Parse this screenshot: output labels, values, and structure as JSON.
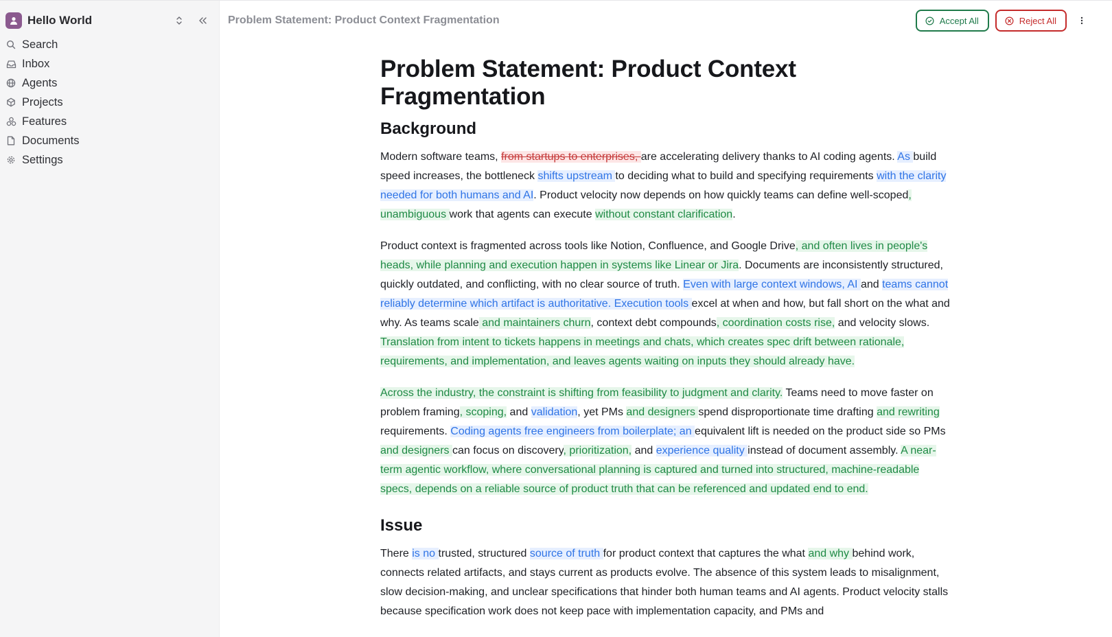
{
  "sidebar": {
    "workspace_name": "Hello World",
    "items": [
      {
        "label": "Search"
      },
      {
        "label": "Inbox"
      },
      {
        "label": "Agents"
      },
      {
        "label": "Projects"
      },
      {
        "label": "Features"
      },
      {
        "label": "Documents"
      },
      {
        "label": "Settings"
      }
    ]
  },
  "header": {
    "breadcrumb": "Problem Statement: Product Context Fragmentation",
    "accept_all": "Accept All",
    "reject_all": "Reject All"
  },
  "doc": {
    "title": "Problem Statement: Product Context Fragmentation",
    "background_heading": "Background",
    "issue_heading": "Issue",
    "p1": [
      {
        "t": "Modern software teams, ",
        "k": "n"
      },
      {
        "t": "from startups to enterprises, ",
        "k": "del"
      },
      {
        "t": "are accelerating delivery thanks to AI coding agents. ",
        "k": "n"
      },
      {
        "t": "As ",
        "k": "mod"
      },
      {
        "t": "build speed increases, the bottleneck ",
        "k": "n"
      },
      {
        "t": "shifts upstream ",
        "k": "mod"
      },
      {
        "t": "to deciding what to build and specifying requirements ",
        "k": "n"
      },
      {
        "t": "with the clarity needed for both humans and AI",
        "k": "mod"
      },
      {
        "t": ". Product velocity now depends on how quickly teams can define well-scoped",
        "k": "n"
      },
      {
        "t": ", unambiguous ",
        "k": "add"
      },
      {
        "t": "work that agents can execute ",
        "k": "n"
      },
      {
        "t": "without constant clarification",
        "k": "add"
      },
      {
        "t": ".",
        "k": "n"
      }
    ],
    "p2": [
      {
        "t": "Product context is fragmented across tools like Notion, Confluence, and Google Drive",
        "k": "n"
      },
      {
        "t": ", and often lives in people's heads, while planning and execution happen in systems like Linear or Jira",
        "k": "add"
      },
      {
        "t": ". Documents are inconsistently structured, quickly outdated, and conflicting, with no clear source of truth. ",
        "k": "n"
      },
      {
        "t": "Even with large context windows, AI ",
        "k": "mod"
      },
      {
        "t": "and ",
        "k": "n"
      },
      {
        "t": "teams cannot reliably determine which artifact is authoritative. Execution tools ",
        "k": "mod"
      },
      {
        "t": "excel at when and how, but fall short on the what and why. As teams scale",
        "k": "n"
      },
      {
        "t": " and maintainers churn",
        "k": "add"
      },
      {
        "t": ", context debt compounds",
        "k": "n"
      },
      {
        "t": ", coordination costs rise,",
        "k": "add"
      },
      {
        "t": " and velocity slows. ",
        "k": "n"
      },
      {
        "t": "Translation from intent to tickets happens in meetings and chats, which creates spec drift between rationale, requirements, and implementation, and leaves agents waiting on inputs they should already have.",
        "k": "add"
      }
    ],
    "p3": [
      {
        "t": "Across the industry, the constraint is shifting from feasibility to judgment and clarity.",
        "k": "add"
      },
      {
        "t": " Teams need to move faster on problem framing",
        "k": "n"
      },
      {
        "t": ", scoping,",
        "k": "add"
      },
      {
        "t": " and ",
        "k": "n"
      },
      {
        "t": "validation",
        "k": "mod"
      },
      {
        "t": ", yet PMs ",
        "k": "n"
      },
      {
        "t": "and designers ",
        "k": "add"
      },
      {
        "t": "spend disproportionate time drafting ",
        "k": "n"
      },
      {
        "t": "and rewriting ",
        "k": "add"
      },
      {
        "t": "requirements. ",
        "k": "n"
      },
      {
        "t": "Coding agents free engineers from boilerplate; an ",
        "k": "mod"
      },
      {
        "t": "equivalent lift is needed on the product side so PMs ",
        "k": "n"
      },
      {
        "t": "and designers ",
        "k": "add"
      },
      {
        "t": "can focus on discovery",
        "k": "n"
      },
      {
        "t": ", prioritization,",
        "k": "add"
      },
      {
        "t": " and ",
        "k": "n"
      },
      {
        "t": "experience quality ",
        "k": "mod"
      },
      {
        "t": "instead of document assembly. ",
        "k": "n"
      },
      {
        "t": "A near-term agentic workflow, where conversational planning is captured and turned into structured, machine-readable specs, depends on a reliable source of product truth that can be referenced and updated end to end.",
        "k": "add"
      }
    ],
    "p4": [
      {
        "t": "There ",
        "k": "n"
      },
      {
        "t": "is no ",
        "k": "mod"
      },
      {
        "t": "trusted, structured ",
        "k": "n"
      },
      {
        "t": "source of truth ",
        "k": "mod"
      },
      {
        "t": "for product context that captures the what ",
        "k": "n"
      },
      {
        "t": "and why ",
        "k": "add"
      },
      {
        "t": "behind work, connects related artifacts, and stays current as products evolve. The absence of this system leads to misalignment, slow decision-making, and unclear specifications that hinder both human teams and AI agents. Product velocity stalls because specification work does not keep pace with implementation capacity, and PMs and",
        "k": "n"
      }
    ]
  },
  "colors": {
    "added": "#1f8a45",
    "added_bg": "#e6f6ea",
    "modified": "#2f74e6",
    "modified_bg": "#e6efff",
    "deleted": "#c53a3a",
    "deleted_bg": "#fde6e6",
    "accept_border": "#1f7a4a",
    "reject_border": "#c42a2a"
  },
  "icons": {
    "workspace": "user-avatar-icon",
    "switcher": "chevrons-up-down-icon",
    "collapse": "chevrons-left-icon",
    "search": "search-icon",
    "inbox": "inbox-icon",
    "agents": "globe-icon",
    "projects": "cube-icon",
    "features": "features-icon",
    "documents": "document-icon",
    "settings": "gear-icon",
    "accept": "check-circle-icon",
    "reject": "x-circle-icon",
    "more": "vertical-dots-icon"
  }
}
